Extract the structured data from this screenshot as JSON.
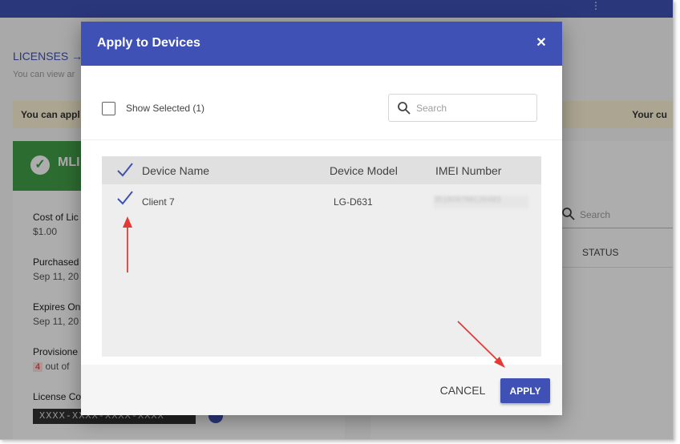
{
  "background": {
    "breadcrumb": "LICENSES →",
    "subtitle": "You can view ar",
    "banner_left": "You can appl",
    "banner_right": "Your cu",
    "license_card": {
      "name": "MLI",
      "items": [
        {
          "label": "Cost of Lic",
          "value": "$1.00"
        },
        {
          "label": "Purchased",
          "value": "Sep 11, 20"
        },
        {
          "label": "Expires On",
          "value": "Sep 11, 20"
        },
        {
          "label": "Provisione",
          "badge": "4",
          "value": "out of"
        },
        {
          "label": "License Co",
          "value": "XXXX-XXXX-XXXX-XXXX"
        }
      ]
    },
    "right_panel": {
      "search_placeholder": "Search",
      "status_header": "STATUS"
    }
  },
  "modal": {
    "title": "Apply to Devices",
    "close_symbol": "✕",
    "show_selected_label": "Show Selected (1)",
    "search_placeholder": "Search",
    "table": {
      "headers": {
        "device_name": "Device Name",
        "device_model": "Device Model",
        "imei": "IMEI Number"
      },
      "rows": [
        {
          "selected": true,
          "device_name": "Client 7",
          "device_model": "LG-D631",
          "imei": "351809788126483"
        }
      ]
    },
    "footer": {
      "cancel_label": "CANCEL",
      "apply_label": "APPLY"
    }
  },
  "colors": {
    "primary": "#3f51b5",
    "success": "#43a047",
    "annotation_arrow": "#e53935"
  },
  "icons": [
    "close-icon",
    "search-icon",
    "check-icon",
    "checkbox-icon"
  ]
}
